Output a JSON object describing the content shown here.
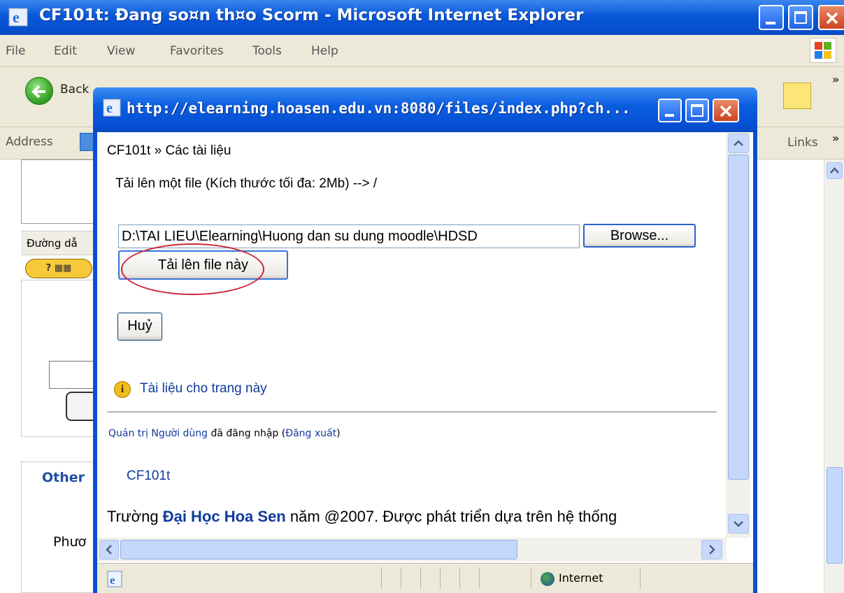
{
  "outer": {
    "title": "CF101t: Đang so¤n th¤o Scorm - Microsoft Internet Explorer",
    "menu": [
      "File",
      "Edit",
      "View",
      "Favorites",
      "Tools",
      "Help"
    ],
    "back_label": "Back",
    "address_label": "Address",
    "links_label": "Links",
    "left_bar_label": "Đường dẫ",
    "help_badge": "?",
    "other_label": "Other",
    "phu_label": "Phươ"
  },
  "popup": {
    "title": "http://elearning.hoasen.edu.vn:8080/files/index.php?ch...",
    "breadcrumb_course": "CF101t",
    "breadcrumb_sep": "»",
    "breadcrumb_page": "Các tài liệu",
    "upload_heading": "Tải lên một file (Kích thước tối đa: 2Mb) --> /",
    "file_path": "D:\\TAI LIEU\\Elearning\\Huong dan su dung moodle\\HDSD",
    "browse_label": "Browse...",
    "upload_label": "Tải lên file này",
    "cancel_label": "Huỷ",
    "doc_link": "Tài liệu cho trang này",
    "login_user": "Quản trị Người dùng",
    "login_text": "đã đăng nhập",
    "logout_link": "Đăng xuất",
    "course_link": "CF101t",
    "footer_prefix": "Trường",
    "footer_school": "Đại Học Hoa Sen",
    "footer_suffix": "năm @2007. Được phát triển dựa trên hệ thống",
    "status_zone": "Internet"
  },
  "colors": {
    "titlebar": "#0a58d8",
    "link": "#103c9c",
    "annotation_ellipse": "#cc2233"
  }
}
